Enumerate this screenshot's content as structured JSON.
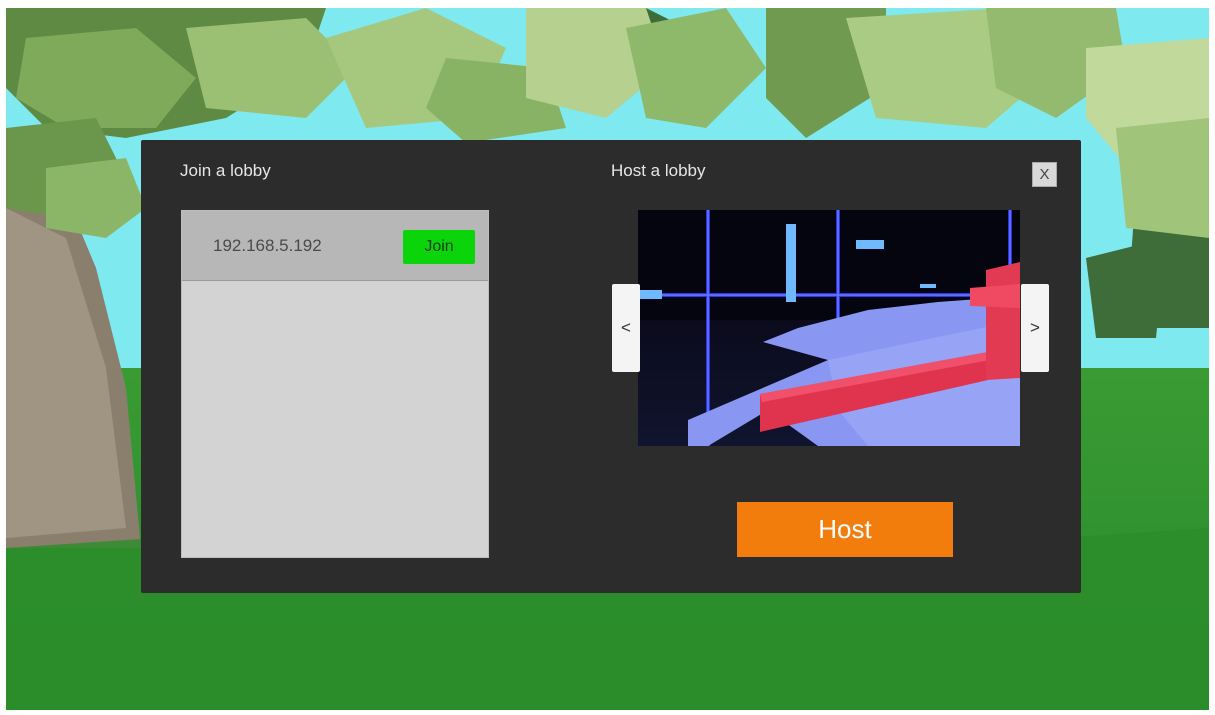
{
  "join": {
    "title": "Join a lobby",
    "lobbies": [
      {
        "address": "192.168.5.192",
        "join_label": "Join"
      }
    ]
  },
  "host": {
    "title": "Host a lobby",
    "prev_label": "<",
    "next_label": ">",
    "host_label": "Host"
  },
  "dialog": {
    "close_label": "X"
  },
  "colors": {
    "dialog_bg": "#2c2c2c",
    "join_button": "#0bd40b",
    "host_button": "#f27d0c",
    "sky": "#7fe9f0",
    "grass": "#2f8f2f"
  }
}
